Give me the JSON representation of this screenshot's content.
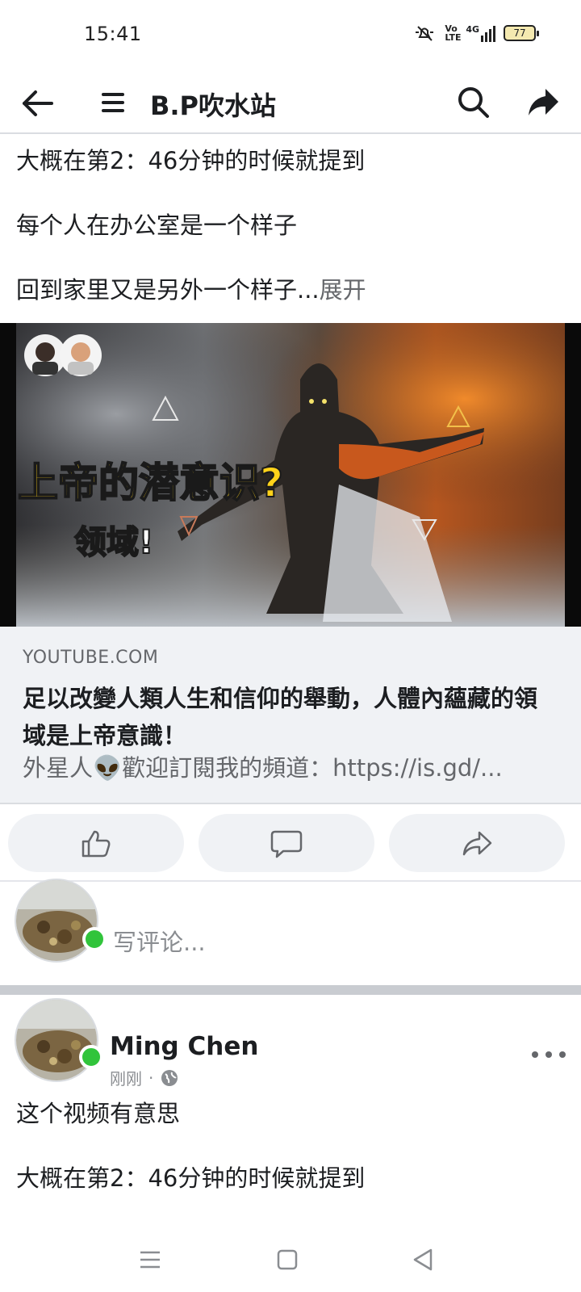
{
  "status_bar": {
    "time": "15:41",
    "signal_text": "4G",
    "volte_text": "Vo LTE",
    "battery": "77"
  },
  "app_bar": {
    "title": "B.P吹水站",
    "icons": [
      "back-arrow-icon",
      "menu-icon",
      "search-icon",
      "share-icon"
    ]
  },
  "post1": {
    "lines": [
      "大概在第2：46分钟的时候就提到",
      "每个人在办公室是一个样子",
      "回到家里又是另外一个样子..."
    ],
    "see_more": "展开",
    "link": {
      "thumbnail": {
        "headline": "上帝的潜意识?",
        "subheadline": "领域!",
        "description": "video thumbnail: half-dark, half-fiery figure between swirling clouds"
      },
      "domain": "YOUTUBE.COM",
      "title": "足以改變人類人生和信仰的舉動，人體內蘊藏的領域是上帝意識！",
      "description": "外星人👽歡迎訂閱我的頻道：https://is.gd/..."
    },
    "actions": [
      "like-icon",
      "comment-icon",
      "share-icon"
    ]
  },
  "composer": {
    "placeholder": "写评论..."
  },
  "post2": {
    "author": "Ming Chen",
    "time": "刚刚",
    "separator": "·",
    "lines": [
      "这个视频有意思",
      "大概在第2：46分钟的时候就提到"
    ]
  },
  "colors": {
    "online": "#31c43b",
    "secondary_text": "#65676b",
    "surface": "#f0f2f5"
  }
}
